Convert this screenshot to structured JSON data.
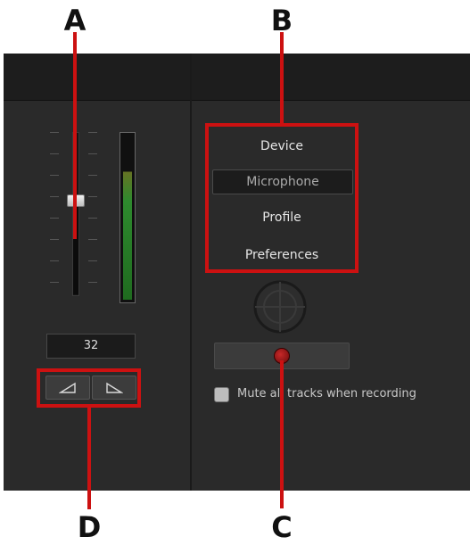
{
  "callouts": {
    "a": "A",
    "b": "B",
    "c": "C",
    "d": "D"
  },
  "record_menu": {
    "device_label": "Device",
    "device_value": "Microphone",
    "profile_label": "Profile",
    "preferences_label": "Preferences"
  },
  "volume": {
    "value": "32",
    "slider_level": 0.58,
    "meter_level": 0.78
  },
  "buttons": {
    "fade_in_icon": "fade-in-icon",
    "fade_out_icon": "fade-out-icon"
  },
  "record_button_icon": "record-icon",
  "mute_option": {
    "label": "Mute all tracks when recording",
    "checked": false
  },
  "colors": {
    "annotation_red": "#cc1111",
    "panel_bg": "#2a2a2a",
    "record_red": "#c62828"
  }
}
